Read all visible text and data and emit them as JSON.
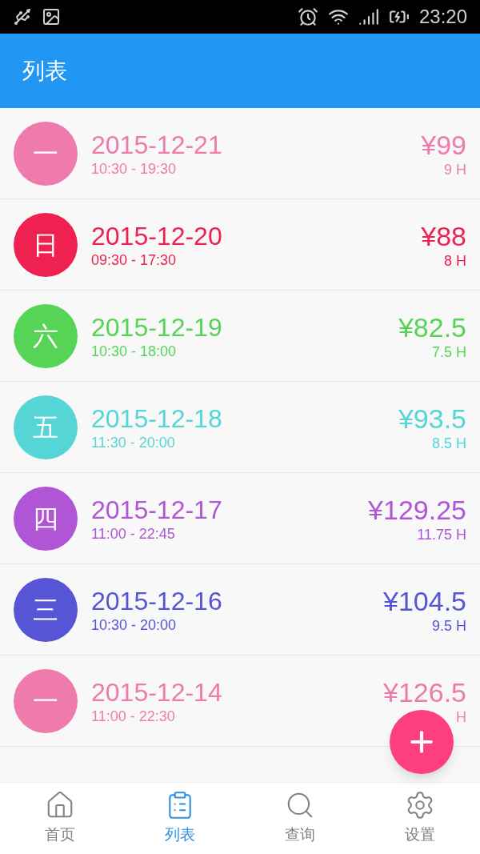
{
  "status_bar": {
    "time": "23:20"
  },
  "app_bar": {
    "title": "列表"
  },
  "records": [
    {
      "weekday": "一",
      "date": "2015-12-21",
      "time_range": "10:30 - 19:30",
      "amount": "¥99",
      "hours": "9 H",
      "color": "#ee7bab"
    },
    {
      "weekday": "日",
      "date": "2015-12-20",
      "time_range": "09:30 - 17:30",
      "amount": "¥88",
      "hours": "8 H",
      "color": "#ee2150"
    },
    {
      "weekday": "六",
      "date": "2015-12-19",
      "time_range": "10:30 - 18:00",
      "amount": "¥82.5",
      "hours": "7.5 H",
      "color": "#55d455"
    },
    {
      "weekday": "五",
      "date": "2015-12-18",
      "time_range": "11:30 - 20:00",
      "amount": "¥93.5",
      "hours": "8.5 H",
      "color": "#55d5d5"
    },
    {
      "weekday": "四",
      "date": "2015-12-17",
      "time_range": "11:00 - 22:45",
      "amount": "¥129.25",
      "hours": "11.75 H",
      "color": "#b055d5"
    },
    {
      "weekday": "三",
      "date": "2015-12-16",
      "time_range": "10:30 - 20:00",
      "amount": "¥104.5",
      "hours": "9.5 H",
      "color": "#5555d5"
    },
    {
      "weekday": "一",
      "date": "2015-12-14",
      "time_range": "11:00 - 22:30",
      "amount": "¥126.5",
      "hours": "H",
      "color": "#ee7bab"
    }
  ],
  "bottom_nav": [
    {
      "kind": "home",
      "label": "首页",
      "selected": false
    },
    {
      "kind": "list",
      "label": "列表",
      "selected": true
    },
    {
      "kind": "search",
      "label": "查询",
      "selected": false
    },
    {
      "kind": "settings",
      "label": "设置",
      "selected": false
    }
  ]
}
